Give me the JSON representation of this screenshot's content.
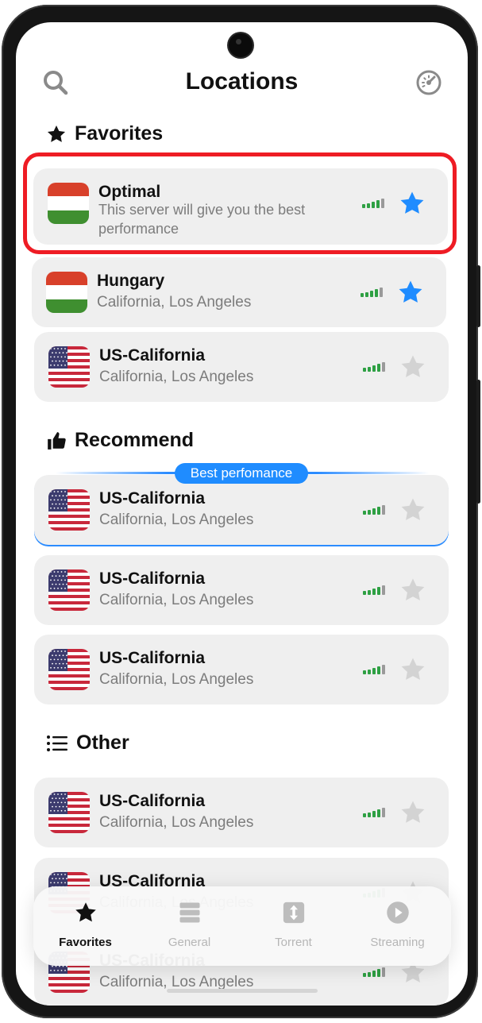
{
  "header": {
    "title": "Locations",
    "search_icon": "search-icon",
    "speed_icon": "speedometer-icon"
  },
  "sections": {
    "favorites": "Favorites",
    "recommend": "Recommend",
    "other": "Other",
    "best_badge": "Best perfomance"
  },
  "colors": {
    "accent": "#1f8cff",
    "highlight": "#ee1c24",
    "signal": "#2ea043",
    "star_off": "#d3d3d3"
  },
  "cards": [
    {
      "name": "Optimal",
      "sub": "This server will give you the best",
      "sub2": "performance",
      "flag": "hungary",
      "favorite": true
    },
    {
      "name": "Hungary",
      "sub": "California, Los Angeles",
      "flag": "hungary",
      "favorite": true
    },
    {
      "name": "US-California",
      "sub": "California, Los Angeles",
      "flag": "usa",
      "favorite": false
    },
    {
      "name": "US-California",
      "sub": "California, Los Angeles",
      "flag": "usa",
      "favorite": false
    },
    {
      "name": "US-California",
      "sub": "California, Los Angeles",
      "flag": "usa",
      "favorite": false
    },
    {
      "name": "US-California",
      "sub": "California, Los Angeles",
      "flag": "usa",
      "favorite": false
    },
    {
      "name": "US-California",
      "sub": "California, Los Angeles",
      "flag": "usa",
      "favorite": false
    },
    {
      "name": "US-California",
      "sub": "California, Los Angeles",
      "flag": "usa",
      "favorite": false
    },
    {
      "name": "US-California",
      "sub": "California, Los Angeles",
      "flag": "usa",
      "favorite": false
    }
  ],
  "tabs": [
    {
      "label": "Favorites",
      "icon": "star-icon",
      "active": true
    },
    {
      "label": "General",
      "icon": "server-stack-icon",
      "active": false
    },
    {
      "label": "Torrent",
      "icon": "torrent-icon",
      "active": false
    },
    {
      "label": "Streaming",
      "icon": "play-icon",
      "active": false
    }
  ]
}
